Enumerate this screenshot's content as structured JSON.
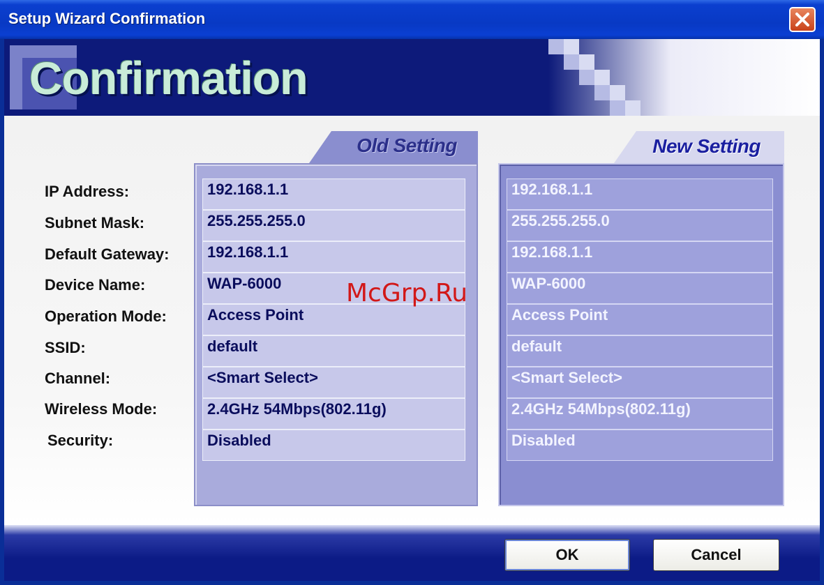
{
  "window": {
    "title": "Setup Wizard Confirmation"
  },
  "banner": {
    "title": "Confirmation"
  },
  "columns": {
    "old": "Old Setting",
    "new": "New Setting"
  },
  "labels": [
    "IP Address:",
    "Subnet Mask:",
    "Default Gateway:",
    "Device Name:",
    "Operation Mode:",
    "SSID:",
    "Channel:",
    "Wireless Mode:",
    "Security:"
  ],
  "old_values": [
    "192.168.1.1",
    "255.255.255.0",
    "192.168.1.1",
    "WAP-6000",
    "Access Point",
    "default",
    "<Smart Select>",
    "2.4GHz 54Mbps(802.11g)",
    "Disabled"
  ],
  "new_values": [
    "192.168.1.1",
    "255.255.255.0",
    "192.168.1.1",
    "WAP-6000",
    "Access Point",
    "default",
    "<Smart Select>",
    "2.4GHz 54Mbps(802.11g)",
    "Disabled"
  ],
  "buttons": {
    "ok": "OK",
    "cancel": "Cancel"
  },
  "watermark": "McGrp.Ru",
  "icons": {
    "close": "close-icon"
  },
  "colors": {
    "titlebar": "#0839c4",
    "banner": "#0d1a7a",
    "close": "#c9421a"
  }
}
